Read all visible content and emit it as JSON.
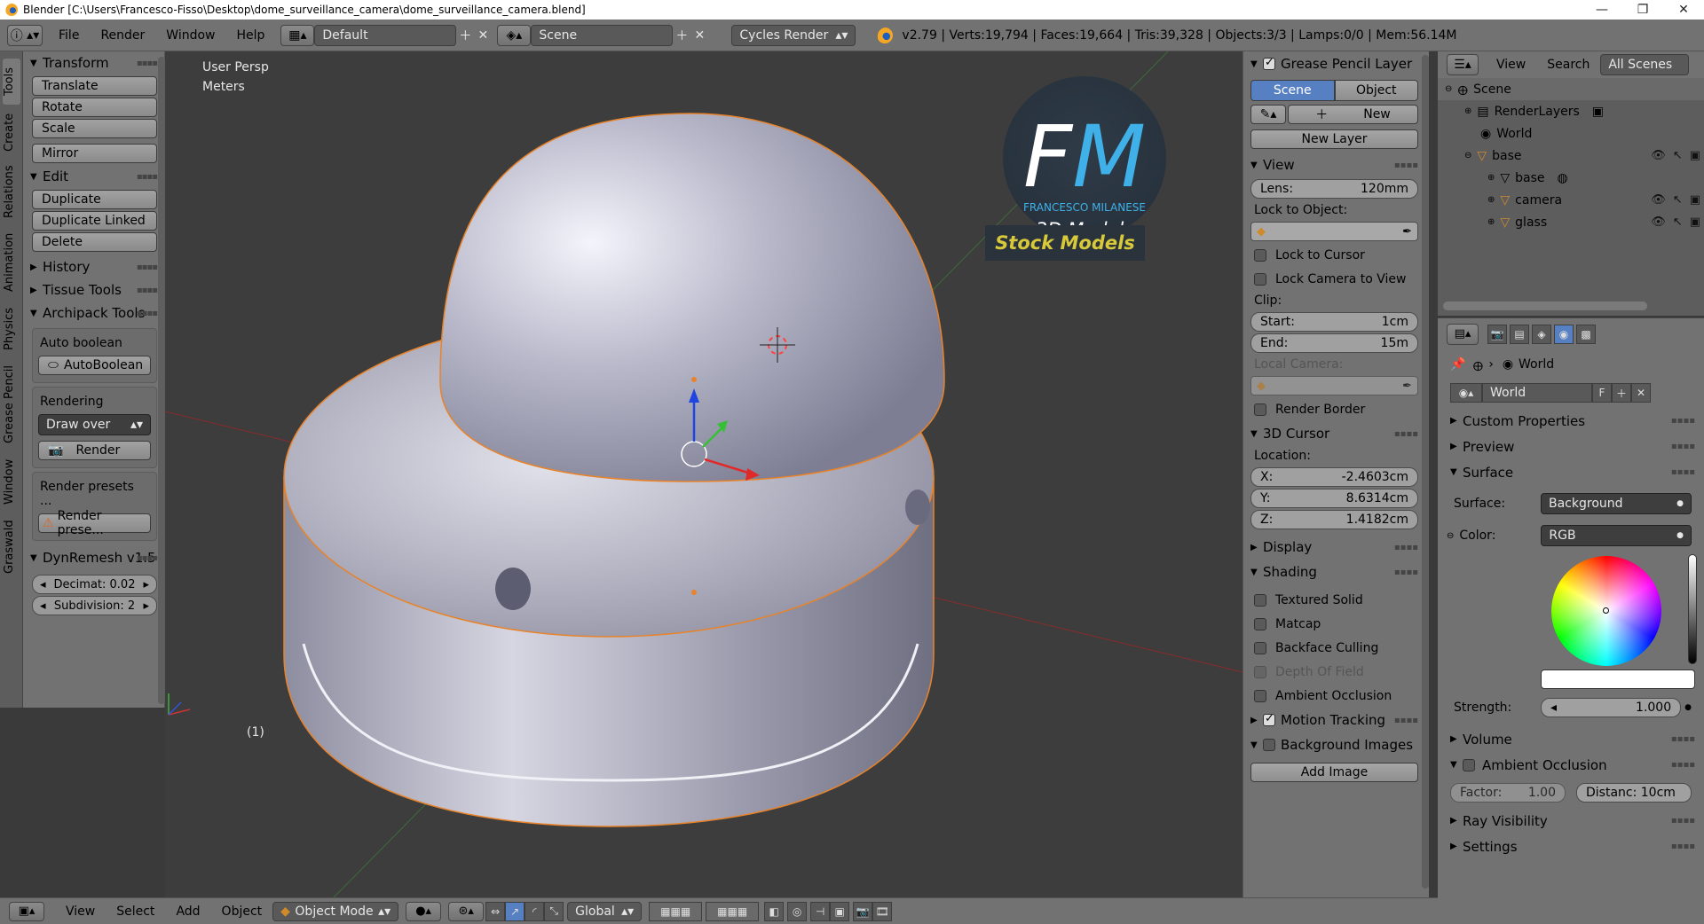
{
  "window": {
    "title": "Blender [C:\\Users\\Francesco-Fisso\\Desktop\\dome_surveillance_camera\\dome_surveillance_camera.blend]",
    "minimize": "—",
    "maximize": "❐",
    "close": "✕"
  },
  "infobar": {
    "info_icon": "ⓘ",
    "menus": [
      "File",
      "Render",
      "Window",
      "Help"
    ],
    "screen_layout": "Default",
    "scene": "Scene",
    "render_engine": "Cycles Render",
    "stats": "v2.79 | Verts:19,794 | Faces:19,664 | Tris:39,328 | Objects:3/3 | Lamps:0/0 | Mem:56.14M"
  },
  "tool_tabs": [
    "Tools",
    "Create",
    "Relations",
    "Animation",
    "Physics",
    "Grease Pencil",
    "Window",
    "Graswald"
  ],
  "toolshelf": {
    "transform": {
      "title": "Transform",
      "buttons": [
        "Translate",
        "Rotate",
        "Scale"
      ],
      "mirror": "Mirror"
    },
    "edit": {
      "title": "Edit",
      "buttons": [
        "Duplicate",
        "Duplicate Linked",
        "Delete"
      ]
    },
    "history": "History",
    "tissue": "Tissue Tools",
    "archipack": {
      "title": "Archipack Tools",
      "auto_boolean_label": "Auto boolean",
      "auto_boolean_btn": "AutoBoolean",
      "rendering_label": "Rendering",
      "draw_over": "Draw over",
      "render_btn": "Render",
      "render_presets_label": "Render presets ...",
      "render_presets_btn": "Render prese..."
    },
    "dynremesh": {
      "title": "DynRemesh v1.5",
      "decimat": "Decimat: 0.02",
      "subdivision": "Subdivision: 2"
    }
  },
  "viewport": {
    "view_name": "User Persp",
    "units": "Meters",
    "frame": "(1)",
    "logo": {
      "letters": "FM",
      "name": "FRANCESCO MILANESE",
      "tagline": "3D Models",
      "stock": "Stock Models"
    }
  },
  "npanel": {
    "grease_pencil": {
      "title": "Grease Pencil Layer",
      "scene_tab": "Scene",
      "object_tab": "Object",
      "new_btn": "New",
      "new_layer_btn": "New Layer"
    },
    "view": {
      "title": "View",
      "lens_label": "Lens:",
      "lens_value": "120mm",
      "lock_to_object": "Lock to Object:",
      "lock_to_cursor": "Lock to Cursor",
      "lock_camera": "Lock Camera to View",
      "clip": "Clip:",
      "start_label": "Start:",
      "start_value": "1cm",
      "end_label": "End:",
      "end_value": "15m",
      "local_camera": "Local Camera:",
      "render_border": "Render Border"
    },
    "cursor": {
      "title": "3D Cursor",
      "location": "Location:",
      "x_label": "X:",
      "x_value": "-2.4603cm",
      "y_label": "Y:",
      "y_value": "8.6314cm",
      "z_label": "Z:",
      "z_value": "1.4182cm"
    },
    "display": "Display",
    "shading": {
      "title": "Shading",
      "textured_solid": "Textured Solid",
      "matcap": "Matcap",
      "backface": "Backface Culling",
      "dof": "Depth Of Field",
      "ao": "Ambient Occlusion"
    },
    "motion_tracking": "Motion Tracking",
    "background_images": "Background Images",
    "add_image": "Add Image"
  },
  "outliner": {
    "view": "View",
    "search": "Search",
    "all_scenes": "All Scenes",
    "items": [
      {
        "label": "Scene"
      },
      {
        "label": "RenderLayers"
      },
      {
        "label": "World"
      },
      {
        "label": "base"
      },
      {
        "label": "base"
      },
      {
        "label": "camera"
      },
      {
        "label": "glass"
      }
    ]
  },
  "properties": {
    "breadcrumb": "World",
    "world_name": "World",
    "fake_user": "F",
    "custom_properties": "Custom Properties",
    "preview": "Preview",
    "surface": {
      "title": "Surface",
      "surface_label": "Surface:",
      "surface_value": "Background",
      "color_label": "Color:",
      "color_value": "RGB",
      "strength_label": "Strength:",
      "strength_value": "1.000"
    },
    "volume": "Volume",
    "ambient_occlusion": {
      "title": "Ambient Occlusion",
      "factor_label": "Factor:",
      "factor_value": "1.00",
      "distance": "Distanc: 10cm"
    },
    "ray_visibility": "Ray Visibility",
    "settings": "Settings"
  },
  "footer": {
    "menus": [
      "View",
      "Select",
      "Add",
      "Object"
    ],
    "mode": "Object Mode",
    "orientation": "Global"
  },
  "colors": {
    "accent": "#5680c2",
    "panel_bg": "#727272",
    "viewport_bg": "#3d3d3d",
    "selection_outline": "#e8832a",
    "logo_blue": "#3fb1e8",
    "logo_yellow": "#d7c93a"
  }
}
